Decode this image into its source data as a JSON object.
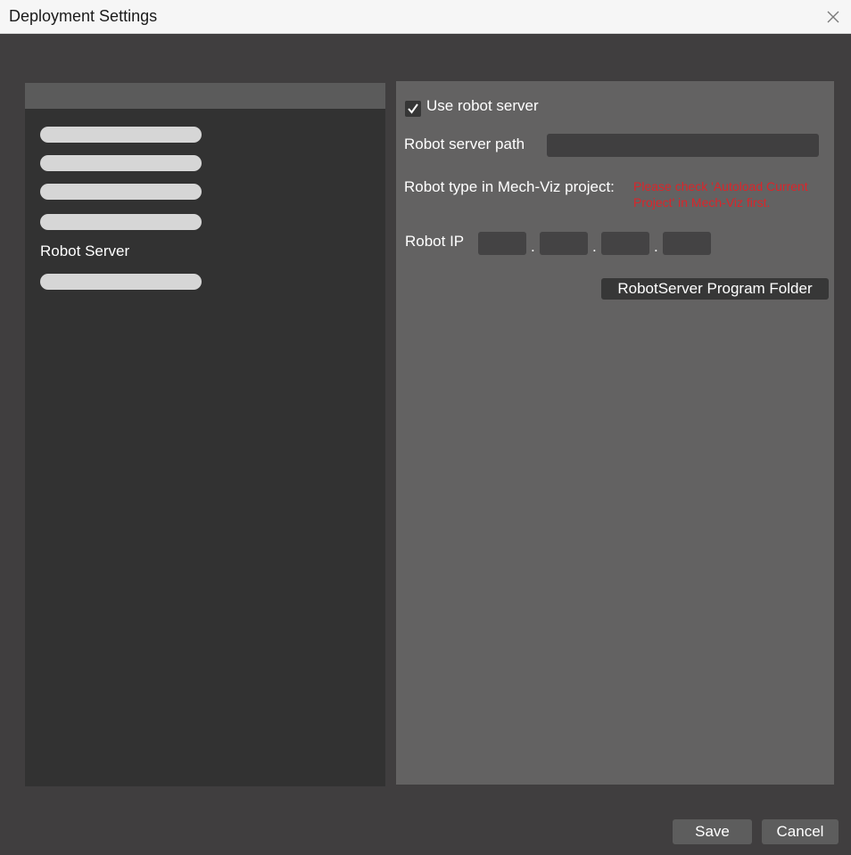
{
  "window": {
    "title": "Deployment Settings",
    "close_icon": "close-icon"
  },
  "sidebar": {
    "items": [
      {
        "label": "",
        "redacted": true
      },
      {
        "label": "",
        "redacted": true
      },
      {
        "label": "",
        "redacted": true
      },
      {
        "label": "",
        "redacted": true
      },
      {
        "label": "Robot Server",
        "redacted": false,
        "selected": true
      },
      {
        "label": "",
        "redacted": true
      }
    ]
  },
  "robot_server": {
    "use_robot_server_label": "Use robot server",
    "use_robot_server_checked": true,
    "server_path_label": "Robot server path",
    "server_path_value": "",
    "robot_type_label": "Robot type in Mech-Viz project:",
    "robot_type_warning": "Please check 'Autoload Current Project' in Mech-Viz first.",
    "robot_ip_label": "Robot IP",
    "robot_ip_octets": [
      "",
      "",
      "",
      ""
    ],
    "robot_ip_separator": ".",
    "program_folder_button": "RobotServer Program Folder"
  },
  "footer": {
    "save_label": "Save",
    "cancel_label": "Cancel"
  },
  "colors": {
    "window_background": "#403e3f",
    "left_panel": "#323232",
    "right_panel": "#636262",
    "warning_text": "#d9262b",
    "button": "#5d5d5d"
  }
}
